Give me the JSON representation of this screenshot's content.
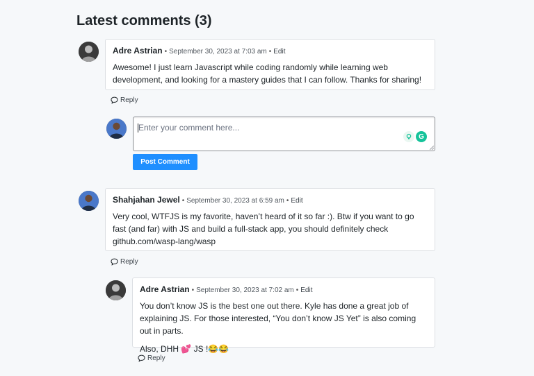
{
  "header": {
    "title": "Latest comments (3)"
  },
  "comments": [
    {
      "author": "Adre Astrian",
      "date": "September 30, 2023 at 7:03 am",
      "edit": "Edit",
      "text": "Awesome! I just learn Javascript while coding randomly while learning web development, and looking for a mastery guides that I can follow. Thanks for sharing!",
      "reply": "Reply"
    },
    {
      "author": "Shahjahan Jewel",
      "date": "September 30, 2023 at 6:59 am",
      "edit": "Edit",
      "text": "Very cool, WTFJS is my favorite, haven’t heard of it so far :). Btw if you want to go fast (and far) with JS and build a full-stack app, you should definitely check github.com/wasp-lang/wasp",
      "reply": "Reply"
    },
    {
      "author": "Adre Astrian",
      "date": "September 30, 2023 at 7:02 am",
      "edit": "Edit",
      "text": "You don’t know JS is the best one out there. Kyle has done a great job of explaining JS. For those interested, “You don’t know JS Yet” is also coming out in parts.",
      "text2": "Also, DHH 💕 JS !😂😂",
      "reply": "Reply"
    }
  ],
  "reply_form": {
    "placeholder": "Enter your comment here...",
    "value": "",
    "submit_label": "Post Comment",
    "grammarly_label": "G"
  },
  "colors": {
    "background": "#f6f8fa",
    "button": "#1f8fff",
    "grammarly": "#15c39a"
  }
}
